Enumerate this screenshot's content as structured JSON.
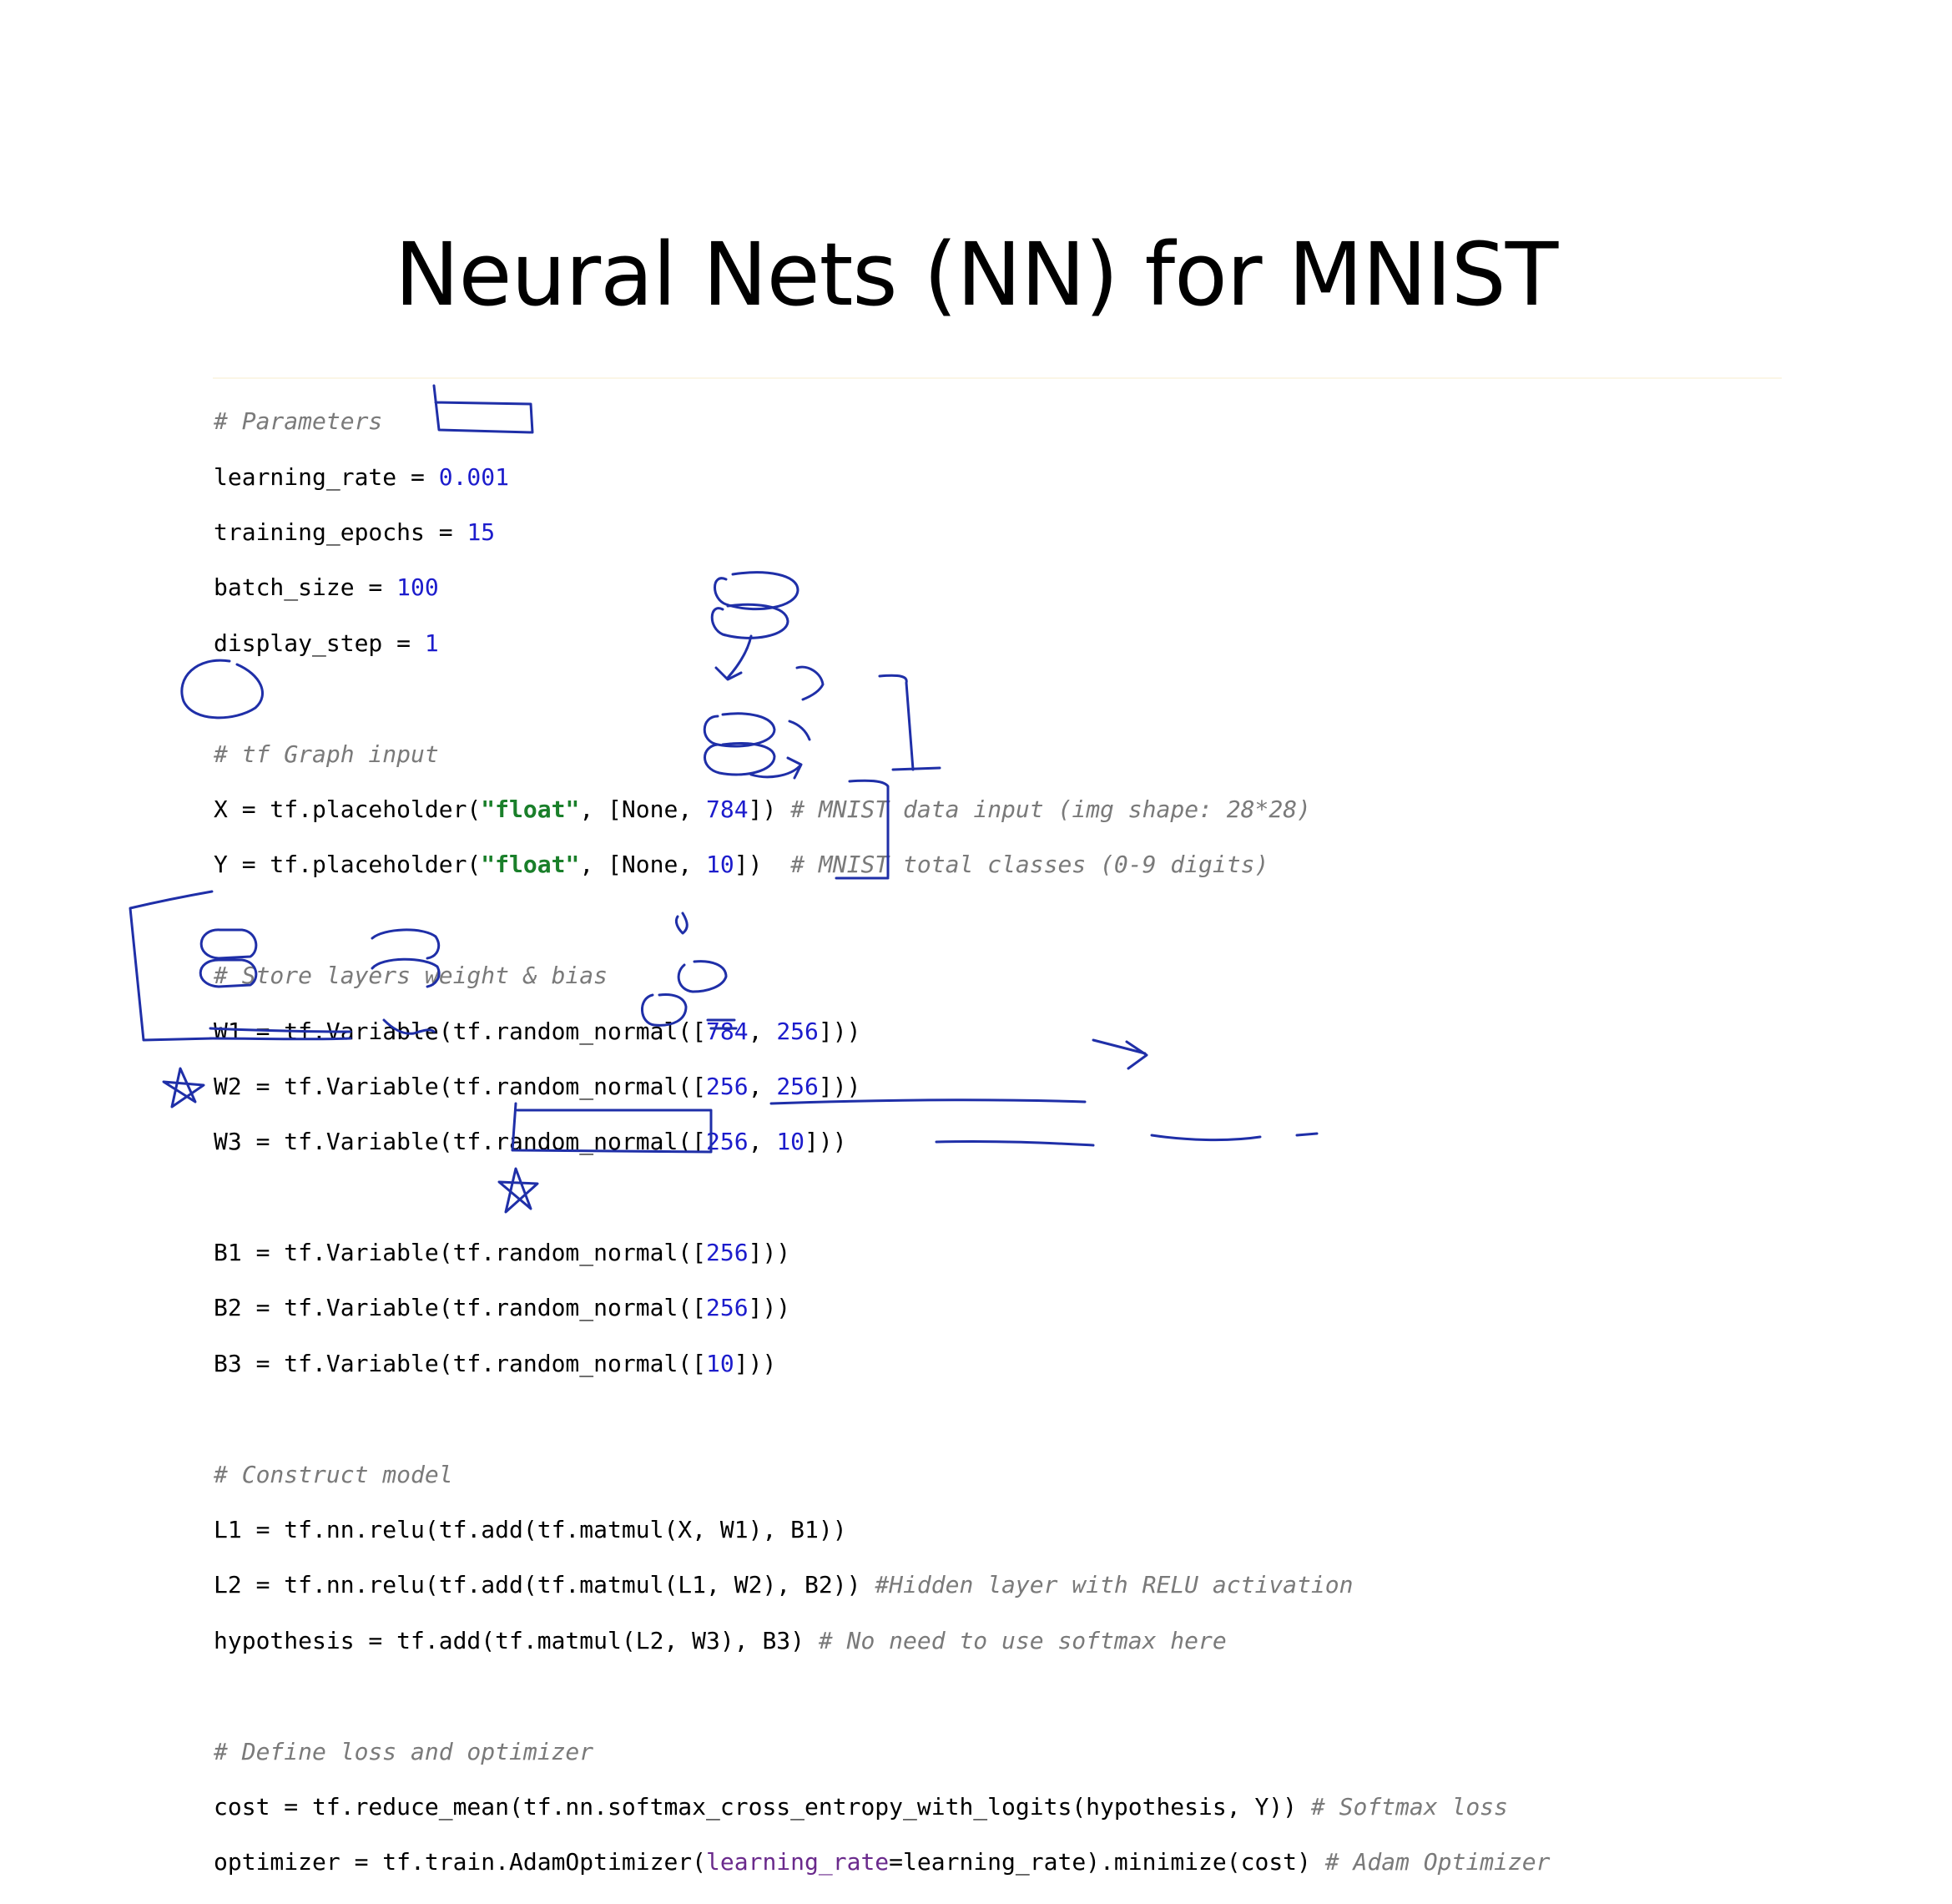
{
  "title": "Neural Nets (NN) for MNIST",
  "code": {
    "l1": "# Parameters",
    "l2a": "learning_rate = ",
    "l2b": "0.001",
    "l3a": "training_epochs = ",
    "l3b": "15",
    "l4a": "batch_size = ",
    "l4b": "100",
    "l5a": "display_step = ",
    "l5b": "1",
    "l7": "# tf Graph input",
    "l8a": "X = tf.placeholder(",
    "l8b": "\"float\"",
    "l8c": ", [None, ",
    "l8d": "784",
    "l8e": "]) ",
    "l8f": "# MNIST data input (img shape: 28*28)",
    "l9a": "Y = tf.placeholder(",
    "l9b": "\"float\"",
    "l9c": ", [None, ",
    "l9d": "10",
    "l9e": "])  ",
    "l9f": "# MNIST total classes (0-9 digits)",
    "l11": "# Store layers weight & bias",
    "l12a": "W1 = tf.Variable(tf.random_normal([",
    "l12b": "784",
    "l12c": ", ",
    "l12d": "256",
    "l12e": "]))",
    "l13a": "W2 = tf.Variable(tf.random_normal([",
    "l13b": "256",
    "l13c": ", ",
    "l13d": "256",
    "l13e": "]))",
    "l14a": "W3 = tf.Variable(tf.random_normal([",
    "l14b": "256",
    "l14c": ", ",
    "l14d": "10",
    "l14e": "]))",
    "l16a": "B1 = tf.Variable(tf.random_normal([",
    "l16b": "256",
    "l16c": "]))",
    "l17a": "B2 = tf.Variable(tf.random_normal([",
    "l17b": "256",
    "l17c": "]))",
    "l18a": "B3 = tf.Variable(tf.random_normal([",
    "l18b": "10",
    "l18c": "]))",
    "l20": "# Construct model",
    "l21": "L1 = tf.nn.relu(tf.add(tf.matmul(X, W1), B1))",
    "l22a": "L2 = tf.nn.relu(tf.add(tf.matmul(L1, W2), B2)) ",
    "l22b": "#Hidden layer with RELU activation",
    "l23a": "hypothesis = tf.add(tf.matmul(L2, W3), B3) ",
    "l23b": "# No need to use softmax here",
    "l25": "# Define loss and optimizer",
    "l26a": "cost = tf.reduce_mean(tf.nn.softmax_cross_entropy_with_logits(hypothesis, Y)) ",
    "l26b": "# Softmax loss",
    "l27a": "optimizer = tf.train.AdamOptimizer(",
    "l27b": "learning_rate",
    "l27c": "=learning_rate).minimize(cost) ",
    "l27d": "# Adam Optimizer"
  },
  "colors": {
    "number": "#1c1ccc",
    "string": "#1a7f2a",
    "comment": "#7a7a7a",
    "keyword_arg": "#6a2a8c",
    "ink": "#1f2fa8"
  }
}
